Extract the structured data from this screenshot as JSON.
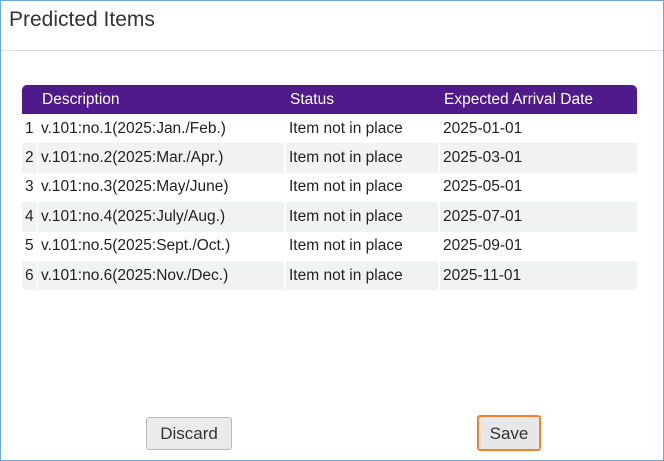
{
  "dialog": {
    "title": "Predicted Items"
  },
  "table": {
    "headers": {
      "index": "",
      "description": "Description",
      "status": "Status",
      "expected_date": "Expected Arrival Date"
    },
    "rows": [
      {
        "index": "1",
        "description": "v.101:no.1(2025:Jan./Feb.)",
        "status": "Item not in place",
        "expected_date": "2025-01-01"
      },
      {
        "index": "2",
        "description": "v.101:no.2(2025:Mar./Apr.)",
        "status": "Item not in place",
        "expected_date": "2025-03-01"
      },
      {
        "index": "3",
        "description": "v.101:no.3(2025:May/June)",
        "status": "Item not in place",
        "expected_date": "2025-05-01"
      },
      {
        "index": "4",
        "description": "v.101:no.4(2025:July/Aug.)",
        "status": "Item not in place",
        "expected_date": "2025-07-01"
      },
      {
        "index": "5",
        "description": "v.101:no.5(2025:Sept./Oct.)",
        "status": "Item not in place",
        "expected_date": "2025-09-01"
      },
      {
        "index": "6",
        "description": "v.101:no.6(2025:Nov./Dec.)",
        "status": "Item not in place",
        "expected_date": "2025-11-01"
      }
    ]
  },
  "buttons": {
    "discard_label": "Discard",
    "save_label": "Save"
  },
  "colors": {
    "header_bg": "#4f1a8a",
    "dialog_border": "#6fa8d6",
    "save_focus_border": "#f0842c",
    "row_alt_bg": "#f1f2f2"
  }
}
